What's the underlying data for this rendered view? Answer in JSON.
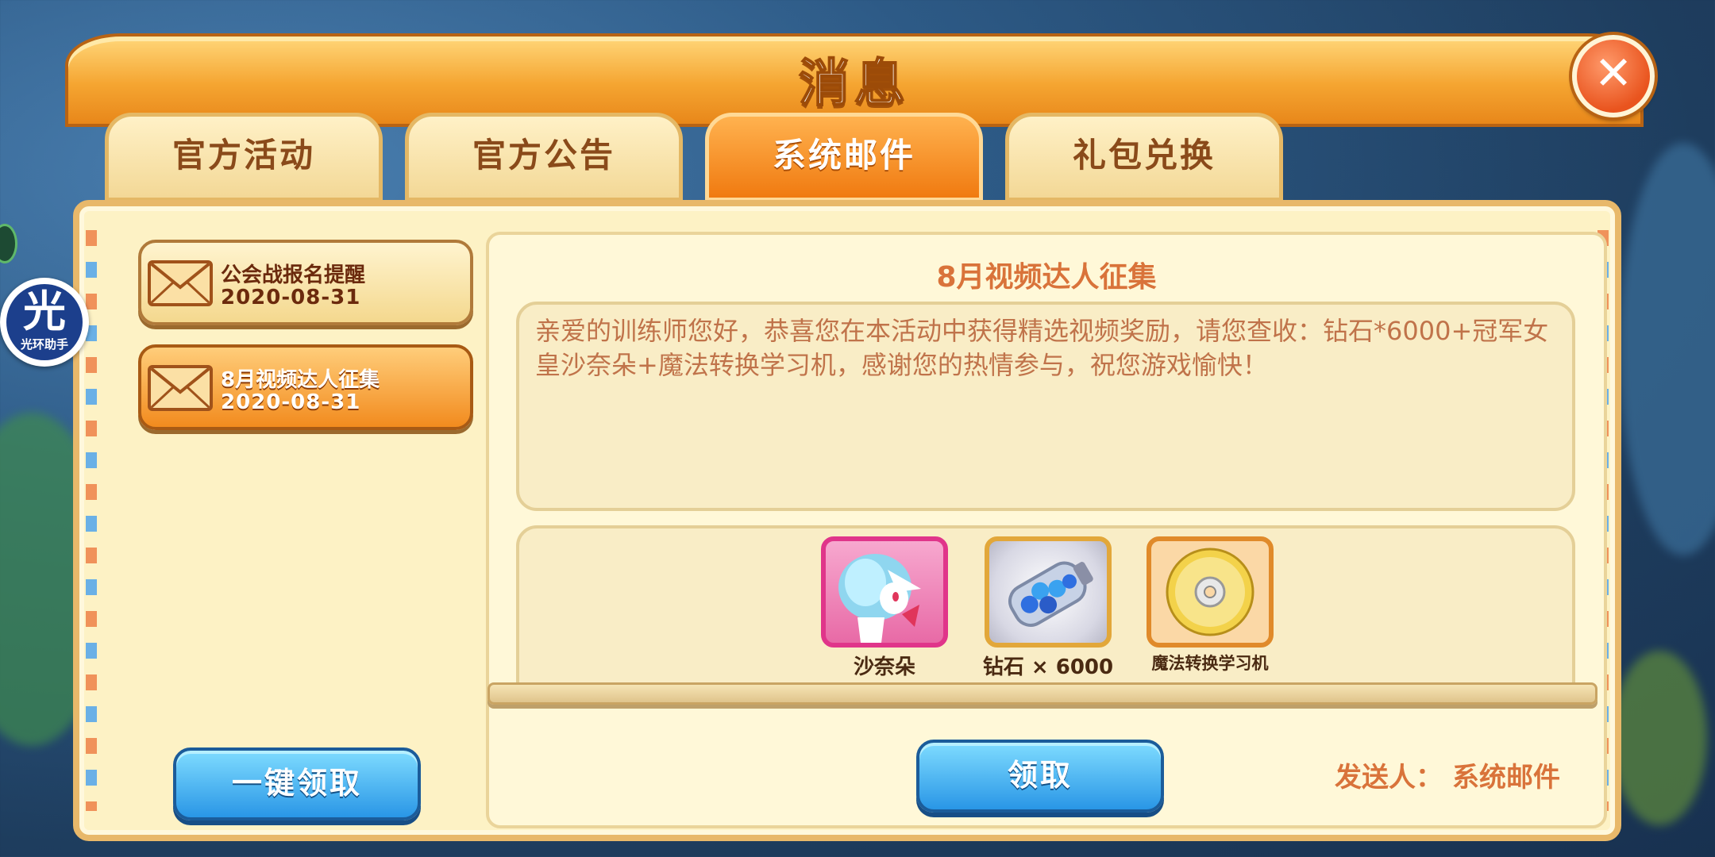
{
  "dialog": {
    "title": "消息",
    "close_icon": "close-icon"
  },
  "tabs": [
    {
      "label": "官方活动",
      "active": false
    },
    {
      "label": "官方公告",
      "active": false
    },
    {
      "label": "系统邮件",
      "active": true
    },
    {
      "label": "礼包兑换",
      "active": false
    }
  ],
  "mail_list": [
    {
      "subject": "公会战报名提醒",
      "date": "2020-08-31",
      "selected": false,
      "icon": "envelope-icon"
    },
    {
      "subject": "8月视频达人征集",
      "date": "2020-08-31",
      "selected": true,
      "icon": "envelope-icon"
    }
  ],
  "claim_all_label": "一键领取",
  "detail": {
    "title": "8月视频达人征集",
    "body": "亲爱的训练师您好，恭喜您在本活动中获得精选视频奖励，请您查收：钻石*6000+冠军女皇沙奈朵+魔法转换学习机，感谢您的热情参与，祝您游戏愉快！",
    "rewards": [
      {
        "label": "沙奈朵",
        "icon": "gardevoir-portrait-icon",
        "frame_color": "#e0358a"
      },
      {
        "label": "钻石 × 6000",
        "icon": "diamond-bottle-icon",
        "frame_color": "#e2a73a"
      },
      {
        "label": "魔法转换学习机",
        "icon": "disc-icon",
        "frame_color": "#e08a2a"
      }
    ],
    "claim_label": "领取",
    "sender_label": "发送人：",
    "sender": "系统邮件"
  },
  "overlay": {
    "helper_glyph": "光",
    "helper_label": "光环助手"
  }
}
